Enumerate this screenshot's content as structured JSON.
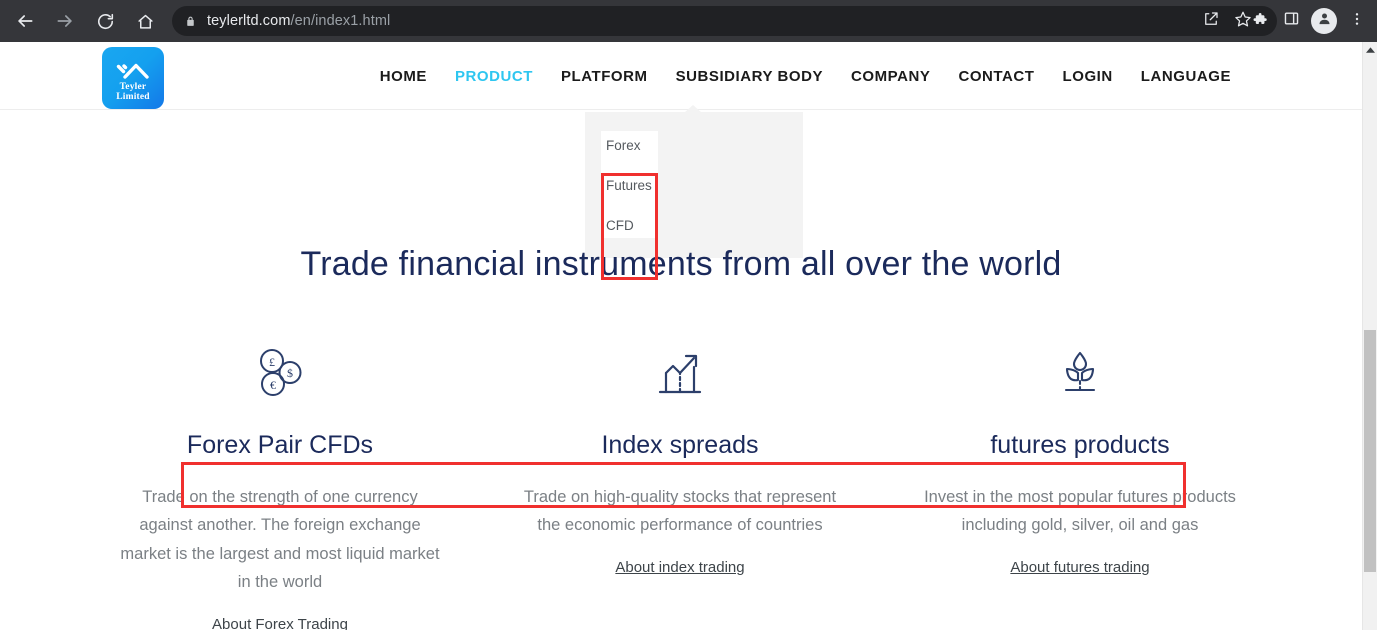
{
  "browser": {
    "back_label": "Back",
    "forward_label": "Forward",
    "reload_label": "Reload",
    "home_label": "Home",
    "url_host": "teylerltd.com",
    "url_path": "/en/index1.html",
    "icons": {
      "lock": "lock-icon",
      "share": "share-icon",
      "bookmark": "star-icon",
      "extensions": "puzzle-icon",
      "side_panel": "side-panel-icon",
      "profile": "profile-avatar-icon",
      "menu": "three-dot-menu-icon"
    }
  },
  "site": {
    "logo_text": "Teyler Limited",
    "nav": [
      {
        "label": "HOME",
        "active": false
      },
      {
        "label": "PRODUCT",
        "active": true
      },
      {
        "label": "PLATFORM",
        "active": false
      },
      {
        "label": "SUBSIDIARY BODY",
        "active": false
      },
      {
        "label": "COMPANY",
        "active": false
      },
      {
        "label": "CONTACT",
        "active": false
      },
      {
        "label": "LOGIN",
        "active": false
      },
      {
        "label": "LANGUAGE",
        "active": false
      }
    ],
    "dropdown": {
      "items": [
        {
          "label": "Forex"
        },
        {
          "label": "Futures"
        },
        {
          "label": "CFD"
        }
      ]
    },
    "hero_heading": "Trade financial instruments from all over the world",
    "features": [
      {
        "icon": "coins-icon",
        "title": "Forex Pair CFDs",
        "description": "Trade on the strength of one currency against another. The foreign exchange market is the largest and most liquid market in the world",
        "link": "About Forex Trading"
      },
      {
        "icon": "chart-growth-icon",
        "title": "Index spreads",
        "description": "Trade on high-quality stocks that represent the economic performance of countries",
        "link": "About index trading"
      },
      {
        "icon": "commodity-sprout-icon",
        "title": "futures products",
        "description": "Invest in the most popular futures products including gold, silver, oil and gas",
        "link": "About futures trading"
      }
    ]
  },
  "annotations": {
    "color": "#f0302e",
    "dropdown_box_label": "red-highlight-dropdown-items",
    "titles_box_label": "red-highlight-feature-titles"
  },
  "colors": {
    "accent": "#2ec6f0",
    "brand_navy": "#1b2a5b",
    "logo_blue": "#14a0ef",
    "body_text": "#7b8085",
    "annotation_red": "#f0302e"
  }
}
